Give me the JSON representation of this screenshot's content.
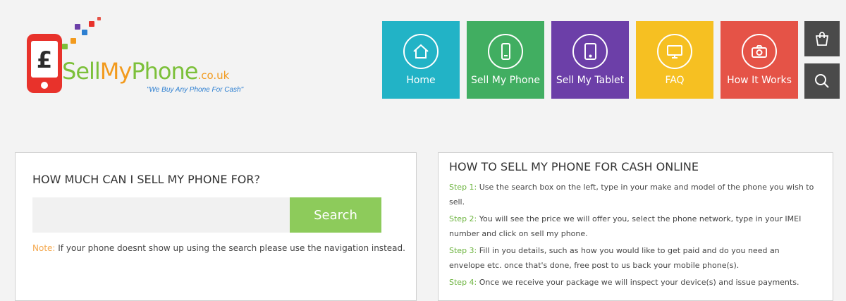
{
  "logo": {
    "brand_sell": "Sell",
    "brand_my": "My",
    "brand_phone": "Phone",
    "brand_tld": ".co.uk",
    "tagline": "\"We Buy Any Phone For Cash\"",
    "phone_symbol": "£"
  },
  "nav": {
    "tiles": [
      {
        "label": "Home",
        "icon": "home-icon",
        "color": "#22b3c6"
      },
      {
        "label": "Sell My Phone",
        "icon": "phone-icon",
        "color": "#41ae61"
      },
      {
        "label": "Sell My Tablet",
        "icon": "tablet-icon",
        "color": "#6c3fa8"
      },
      {
        "label": "FAQ",
        "icon": "monitor-icon",
        "color": "#f6c022"
      },
      {
        "label": "How It Works",
        "icon": "camera-icon",
        "color": "#e55347"
      }
    ],
    "basket_icon": "basket-icon",
    "search_icon": "search-icon"
  },
  "search_panel": {
    "title": "HOW MUCH CAN I SELL MY PHONE FOR?",
    "input_value": "",
    "input_placeholder": "",
    "button_label": "Search",
    "note_label": "Note:",
    "note_text": " If your phone doesnt show up using the search please use the navigation instead."
  },
  "howto_panel": {
    "title": "HOW TO SELL MY PHONE FOR CASH ONLINE",
    "steps": [
      {
        "label": "Step 1:",
        "text": " Use the search box on the left, type in your make and model of the phone you wish to sell."
      },
      {
        "label": "Step 2:",
        "text": " You will see the price we will offer you, select the phone network, type in your IMEI number and click on sell my phone."
      },
      {
        "label": "Step 3:",
        "text": " Fill in you details, such as how you would like to get paid and do you need an envelope etc. once that's done, free post to us back your mobile phone(s)."
      },
      {
        "label": "Step 4:",
        "text": " Once we receive your package we will inspect your device(s) and issue payments."
      }
    ]
  },
  "colors": {
    "background": "#f3f3f3",
    "accent_green": "#8dcb5b",
    "step_green": "#6cb33e",
    "note_orange": "#f4a84e"
  }
}
